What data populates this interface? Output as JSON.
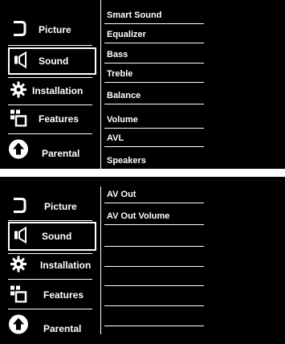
{
  "top_panel": {
    "menu": [
      {
        "label": "Picture",
        "icon": "picture-icon"
      },
      {
        "label": "Sound",
        "icon": "speaker-icon",
        "selected": true
      },
      {
        "label": "Installation",
        "icon": "gear-icon"
      },
      {
        "label": "Features",
        "icon": "features-icon"
      },
      {
        "label": "Parental",
        "icon": "lock-icon"
      }
    ],
    "submenu": [
      "Smart Sound",
      "Equalizer",
      "Bass",
      "Treble",
      "Balance",
      "Volume",
      "AVL",
      "Speakers"
    ]
  },
  "bottom_panel": {
    "menu": [
      {
        "label": "Picture",
        "icon": "picture-icon"
      },
      {
        "label": "Sound",
        "icon": "speaker-icon",
        "selected": true
      },
      {
        "label": "Installation",
        "icon": "gear-icon"
      },
      {
        "label": "Features",
        "icon": "features-icon"
      },
      {
        "label": "Parental",
        "icon": "lock-icon"
      }
    ],
    "submenu": [
      "AV Out",
      "AV Out Volume",
      "",
      "",
      "",
      "",
      ""
    ]
  },
  "colors": {
    "background": "#000000",
    "foreground": "#ffffff"
  }
}
